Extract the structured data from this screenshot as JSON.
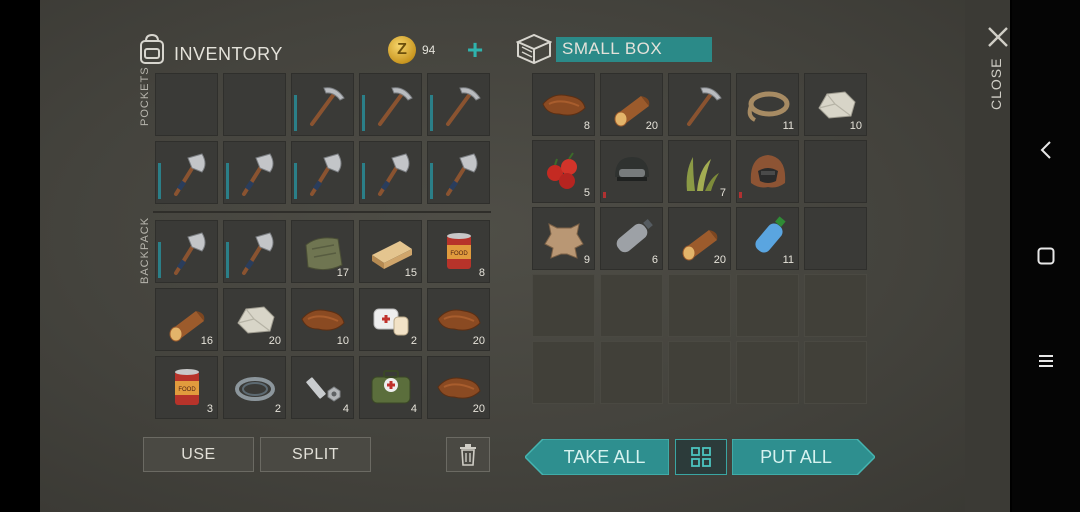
{
  "inventory": {
    "title": "INVENTORY",
    "coins": "94",
    "coin_symbol": "Z",
    "add_label": "+",
    "pockets_label": "POCKETS",
    "backpack_label": "BACKPACK",
    "pockets": [
      {
        "item": "",
        "count": ""
      },
      {
        "item": "",
        "count": ""
      },
      {
        "item": "pickaxe-icon",
        "count": ""
      },
      {
        "item": "pickaxe-icon",
        "count": ""
      },
      {
        "item": "pickaxe-icon",
        "count": ""
      },
      {
        "item": "hatchet-icon",
        "count": ""
      },
      {
        "item": "hatchet-icon",
        "count": ""
      },
      {
        "item": "hatchet-icon",
        "count": ""
      },
      {
        "item": "hatchet-icon",
        "count": ""
      },
      {
        "item": "hatchet-icon",
        "count": ""
      }
    ],
    "backpack": [
      {
        "item": "hatchet-icon",
        "count": ""
      },
      {
        "item": "hatchet-icon",
        "count": ""
      },
      {
        "item": "cloth-icon",
        "count": "17"
      },
      {
        "item": "plank-icon",
        "count": "15"
      },
      {
        "item": "canned-food-icon",
        "count": "8"
      },
      {
        "item": "log-icon",
        "count": "16"
      },
      {
        "item": "stone-icon",
        "count": "20"
      },
      {
        "item": "leather-icon",
        "count": "10"
      },
      {
        "item": "bandage-icon",
        "count": "2"
      },
      {
        "item": "leather-icon",
        "count": "20"
      },
      {
        "item": "canned-food-icon",
        "count": "3"
      },
      {
        "item": "wire-icon",
        "count": "2"
      },
      {
        "item": "bolts-icon",
        "count": "4"
      },
      {
        "item": "medkit-icon",
        "count": "4"
      },
      {
        "item": "leather-icon",
        "count": "20"
      }
    ],
    "use_label": "USE",
    "split_label": "SPLIT"
  },
  "box": {
    "title": "SMALL BOX",
    "items": [
      {
        "item": "leather-icon",
        "count": "8"
      },
      {
        "item": "log-icon",
        "count": "20"
      },
      {
        "item": "pickaxe-icon",
        "count": ""
      },
      {
        "item": "rope-icon",
        "count": "11"
      },
      {
        "item": "stone-icon",
        "count": "10"
      },
      {
        "item": "berries-icon",
        "count": "5"
      },
      {
        "item": "helmet-icon",
        "count": ""
      },
      {
        "item": "plant-fiber-icon",
        "count": "7"
      },
      {
        "item": "hood-icon",
        "count": ""
      },
      {
        "item": "",
        "count": ""
      },
      {
        "item": "animal-hide-icon",
        "count": "9"
      },
      {
        "item": "empty-bottle-icon",
        "count": "6"
      },
      {
        "item": "log-icon",
        "count": "20"
      },
      {
        "item": "water-bottle-icon",
        "count": "11"
      },
      {
        "item": "",
        "count": ""
      }
    ],
    "take_all_label": "TAKE ALL",
    "put_all_label": "PUT ALL"
  },
  "close_label": "CLOSE"
}
